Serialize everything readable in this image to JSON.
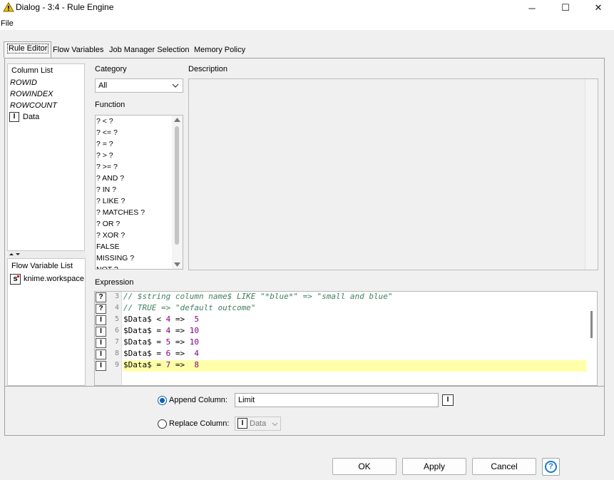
{
  "window": {
    "title": "Dialog - 3:4 - Rule Engine",
    "minimize": "─",
    "maximize": "☐",
    "close": "✕"
  },
  "menu": {
    "file": "File"
  },
  "tabs": [
    "Rule Editor",
    "Flow Variables",
    "Job Manager Selection",
    "Memory Policy"
  ],
  "column_list": {
    "header": "Column List",
    "items": [
      "ROWID",
      "ROWINDEX",
      "ROWCOUNT",
      "Data"
    ],
    "data_type_icon": "I"
  },
  "flow_variable_list": {
    "header": "Flow Variable List",
    "items": [
      "knime.workspace"
    ],
    "type_icon": "s"
  },
  "category": {
    "label": "Category",
    "value": "All"
  },
  "function": {
    "label": "Function",
    "items": [
      "? < ?",
      "? <= ?",
      "? = ?",
      "? > ?",
      "? >= ?",
      "? AND ?",
      "? IN ?",
      "? LIKE ?",
      "? MATCHES ?",
      "? OR ?",
      "? XOR ?",
      "FALSE",
      "MISSING ?",
      "NOT ?"
    ]
  },
  "description": {
    "label": "Description"
  },
  "expression": {
    "label": "Expression",
    "lines": [
      {
        "num": "3",
        "icon": "?",
        "text": "// $string column name$ LIKE \"*blue*\" => \"small and blue\"",
        "kind": "comment"
      },
      {
        "num": "4",
        "icon": "?",
        "text": "// TRUE => \"default outcome\"",
        "kind": "comment"
      },
      {
        "num": "5",
        "icon": "I",
        "lhs": "$Data$",
        "op": " < ",
        "cond": "4",
        "arrow": " =>  ",
        "out": "5"
      },
      {
        "num": "6",
        "icon": "I",
        "lhs": "$Data$",
        "op": " = ",
        "cond": "4",
        "arrow": " => ",
        "out": "10"
      },
      {
        "num": "7",
        "icon": "I",
        "lhs": "$Data$",
        "op": " = ",
        "cond": "5",
        "arrow": " => ",
        "out": "10"
      },
      {
        "num": "8",
        "icon": "I",
        "lhs": "$Data$",
        "op": " = ",
        "cond": "6",
        "arrow": " =>  ",
        "out": "4"
      },
      {
        "num": "9",
        "icon": "I",
        "lhs": "$Data$",
        "op": " = ",
        "cond": "7",
        "arrow": " =>  ",
        "out": "8"
      }
    ]
  },
  "output": {
    "append_label": "Append Column:",
    "append_value": "Limit",
    "append_type_icon": "I",
    "replace_label": "Replace Column:",
    "replace_value": "Data",
    "replace_type_icon": "I"
  },
  "buttons": {
    "ok": "OK",
    "apply": "Apply",
    "cancel": "Cancel",
    "help": "?"
  },
  "colors": {
    "accent": "#0a5fb4",
    "highlight": "#ffffaa",
    "comment": "#3f7f5f",
    "number": "#7f007f",
    "warning_icon": "#f2c200"
  }
}
